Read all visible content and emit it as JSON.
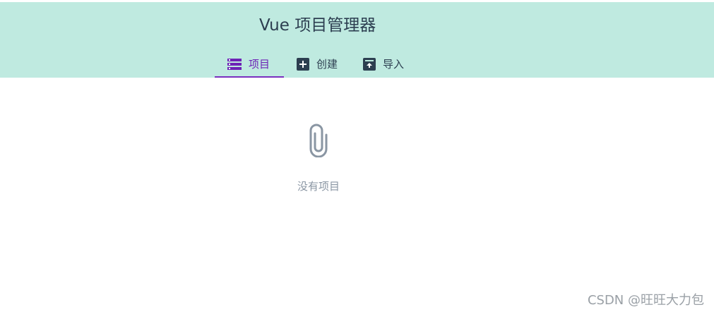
{
  "header": {
    "title": "Vue 项目管理器"
  },
  "tabs": [
    {
      "label": "项目",
      "icon": "list-icon",
      "active": true
    },
    {
      "label": "创建",
      "icon": "add-box-icon",
      "active": false
    },
    {
      "label": "导入",
      "icon": "import-box-icon",
      "active": false
    }
  ],
  "empty_state": {
    "icon": "paperclip-icon",
    "text": "没有项目"
  },
  "watermark": {
    "text": "CSDN @旺旺大力包"
  },
  "colors": {
    "header_bg": "#bfeae0",
    "active_tab": "#7a2fbf",
    "text_dark": "#2c3e50",
    "muted": "#8a96a3"
  }
}
